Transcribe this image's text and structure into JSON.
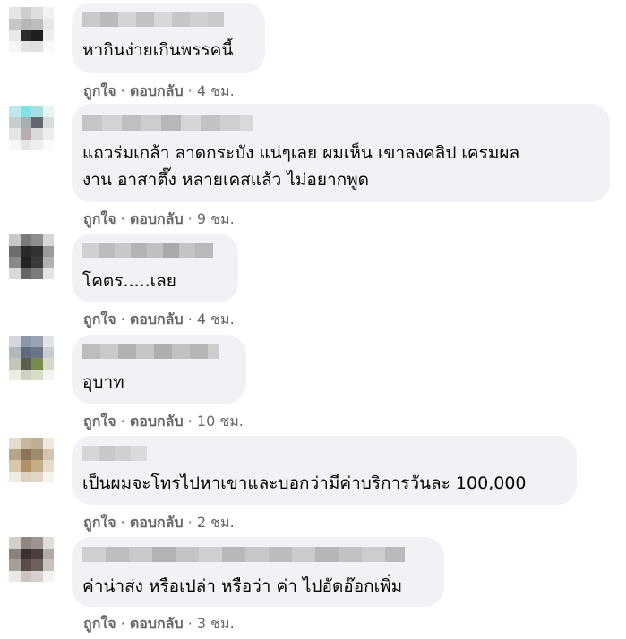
{
  "comments": [
    {
      "text": [
        "หากินง่ายเกินพรรคนี้"
      ],
      "like": "ถูกใจ",
      "sep1": " · ",
      "reply": "ตอบกลับ",
      "sep2": " · ",
      "time": "4 ชม."
    },
    {
      "text": [
        "แถวร่มเกล้า ลาดกระบัง แน่ๆเลย ผมเห็น เขาลงคลิป เครมผล",
        "งาน อาสาตึ๊ง หลายเคสแล้ว ไม่อยากพูด"
      ],
      "like": "ถูกใจ",
      "sep1": " · ",
      "reply": "ตอบกลับ",
      "sep2": " · ",
      "time": "9 ชม."
    },
    {
      "text": [
        "โคตร.....เลย"
      ],
      "like": "ถูกใจ",
      "sep1": " · ",
      "reply": "ตอบกลับ",
      "sep2": " · ",
      "time": "4 ชม."
    },
    {
      "text": [
        "อุบาท"
      ],
      "like": "ถูกใจ",
      "sep1": " · ",
      "reply": "ตอบกลับ",
      "sep2": " · ",
      "time": "10 ชม."
    },
    {
      "text": [
        "เป็นผมจะโทรไปหาเขาและบอกว่ามีค่าบริการวันละ 100,000"
      ],
      "like": "ถูกใจ",
      "sep1": " · ",
      "reply": "ตอบกลับ",
      "sep2": " · ",
      "time": "2 ชม."
    },
    {
      "text": [
        "ค่าน่าส่ง หรือเปล่า หรือว่า ค่า ไปอัดอ๊อกเพิ่ม"
      ],
      "like": "ถูกใจ",
      "sep1": " · ",
      "reply": "ตอบกลับ",
      "sep2": " · ",
      "time": "3 ชม."
    }
  ],
  "colors": {
    "bubble": "#f0f2f5",
    "meta_text": "#65676b",
    "comment_text": "#050505"
  },
  "icons": {
    "avatar": "pixelated-profile-photo",
    "name": "pixelated-author-name"
  }
}
